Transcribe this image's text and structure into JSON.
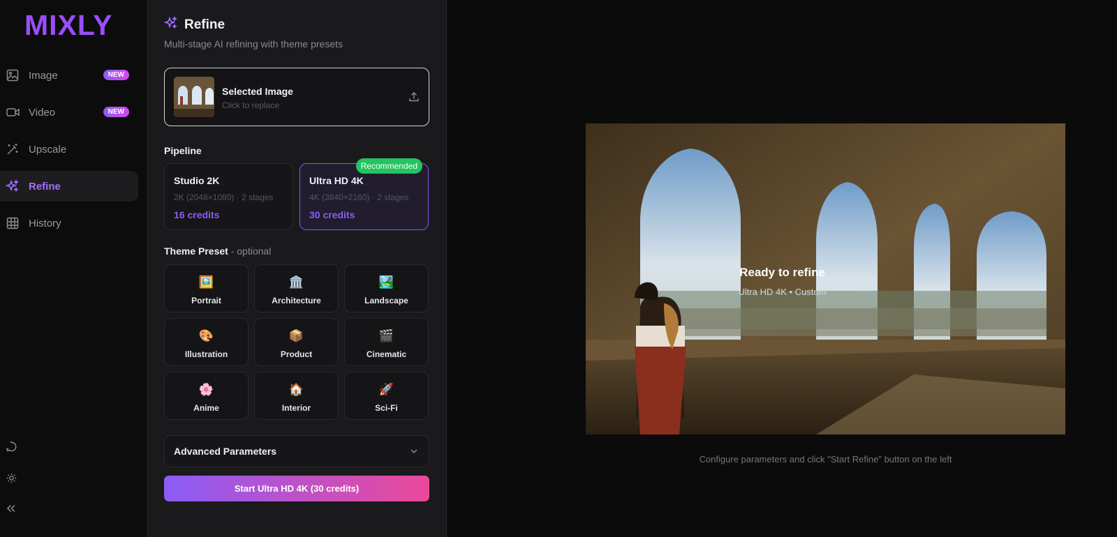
{
  "app": {
    "logo": "MIXLY"
  },
  "nav": {
    "items": [
      {
        "label": "Image",
        "badge": "NEW",
        "icon": "image-icon"
      },
      {
        "label": "Video",
        "badge": "NEW",
        "icon": "video-icon"
      },
      {
        "label": "Upscale",
        "icon": "wand-icon"
      },
      {
        "label": "Refine",
        "icon": "sparkles-icon",
        "active": true
      },
      {
        "label": "History",
        "icon": "grid-icon"
      }
    ],
    "bottom_icons": [
      "chat-icon",
      "sun-icon",
      "collapse-icon"
    ]
  },
  "panel": {
    "title": "Refine",
    "subtitle": "Multi-stage AI refining with theme presets",
    "selected_image": {
      "title": "Selected Image",
      "subtitle": "Click to replace"
    },
    "pipeline_label": "Pipeline",
    "pipelines": [
      {
        "name": "Studio 2K",
        "detail": "2K (2048×1080) · 2 stages",
        "credits": "16 credits"
      },
      {
        "name": "Ultra HD 4K",
        "detail": "4K (3840×2160) · 2 stages",
        "credits": "30 credits",
        "badge": "Recommended",
        "selected": true
      }
    ],
    "theme_label": "Theme Preset",
    "theme_optional": " - optional",
    "themes": [
      {
        "label": "Portrait",
        "emoji": "🖼️"
      },
      {
        "label": "Architecture",
        "emoji": "🏛️"
      },
      {
        "label": "Landscape",
        "emoji": "🏞️"
      },
      {
        "label": "Illustration",
        "emoji": "🎨"
      },
      {
        "label": "Product",
        "emoji": "📦"
      },
      {
        "label": "Cinematic",
        "emoji": "🎬"
      },
      {
        "label": "Anime",
        "emoji": "🌸"
      },
      {
        "label": "Interior",
        "emoji": "🏠"
      },
      {
        "label": "Sci-Fi",
        "emoji": "🚀"
      }
    ],
    "advanced_label": "Advanced Parameters",
    "start_button": "Start Ultra HD 4K (30 credits)"
  },
  "preview": {
    "status": "Ready to refine",
    "status_sub": "Ultra HD 4K • Custom",
    "hint": "Configure parameters and click \"Start Refine\" button on the left"
  },
  "colors": {
    "accent": "#8b5cf6",
    "recommended": "#22c55e",
    "gradient_end": "#ec4899"
  }
}
